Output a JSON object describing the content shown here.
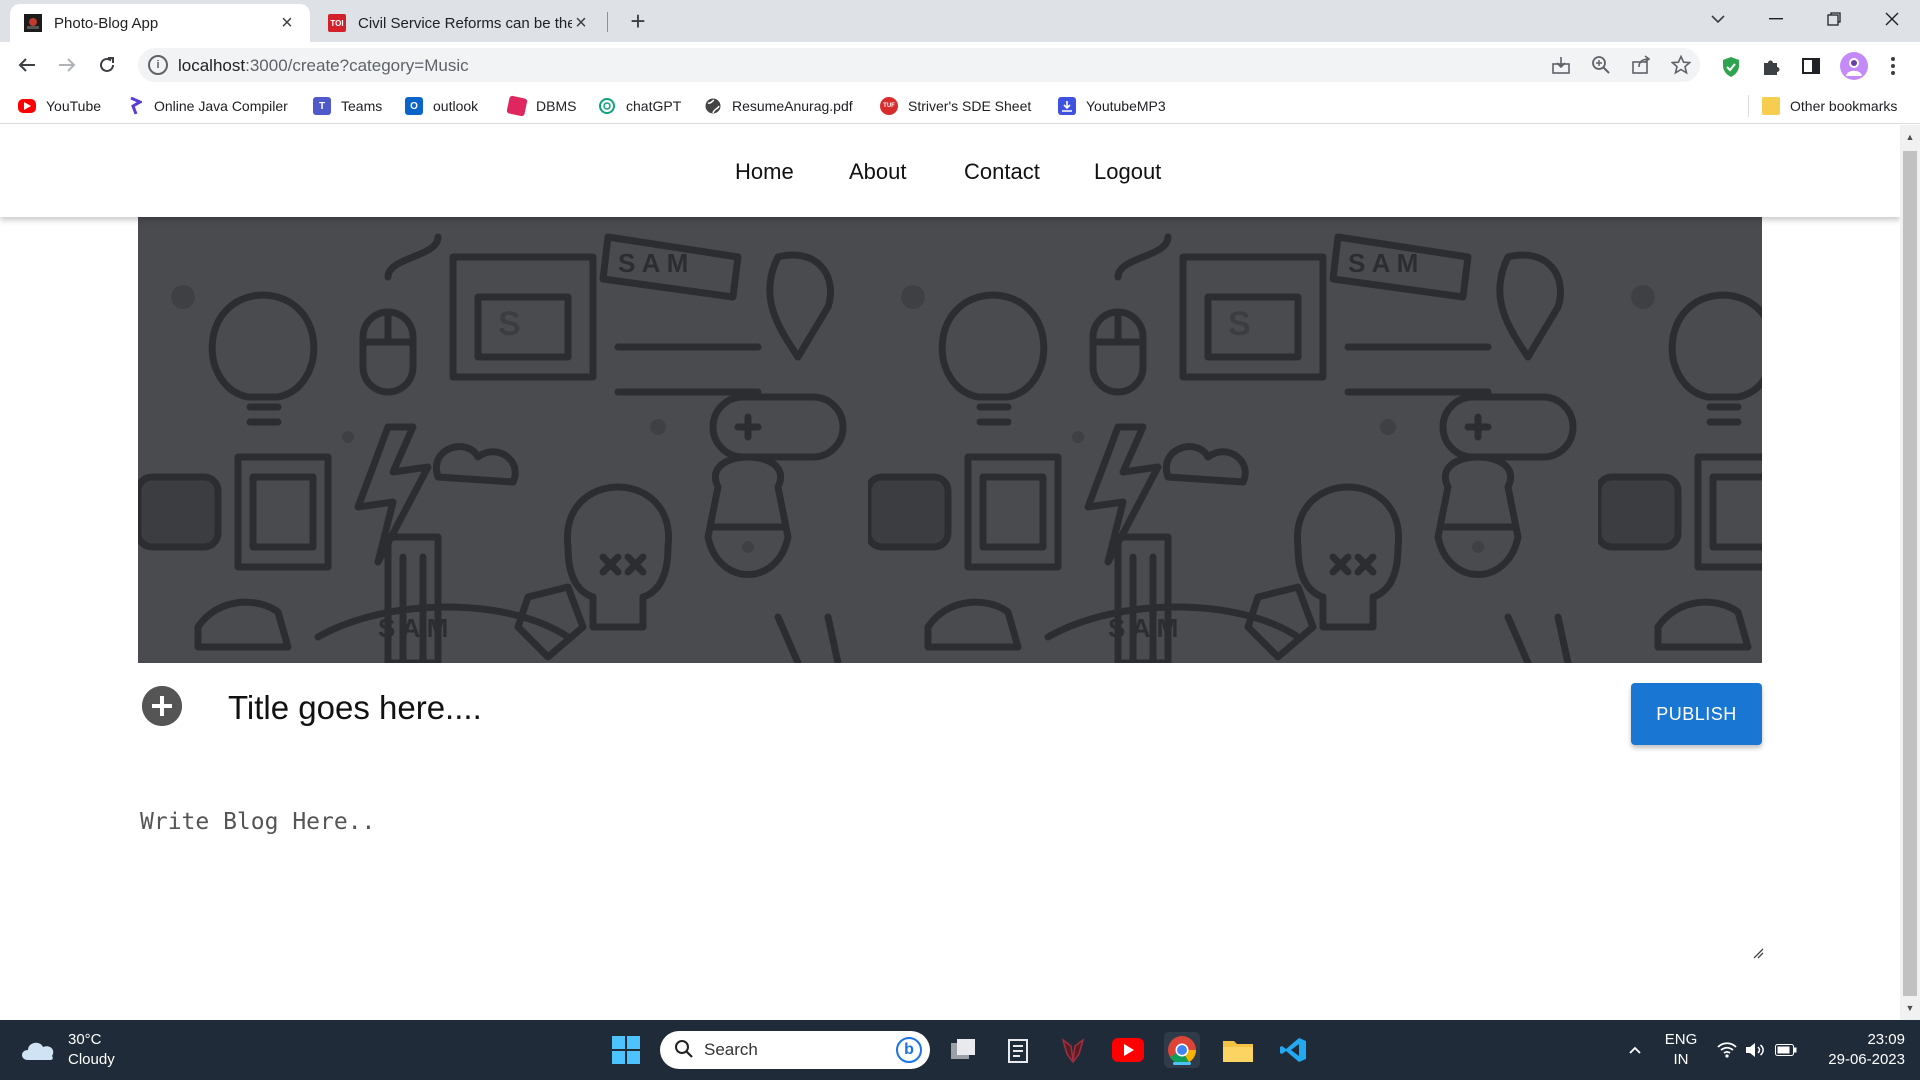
{
  "browser": {
    "tabs": [
      {
        "title": "Photo-Blog App",
        "active": true
      },
      {
        "title": "Civil Service Reforms can be the I",
        "active": false,
        "favicon_text": "TOI"
      }
    ],
    "url": {
      "host": "localhost",
      "rest": ":3000/create?category=Music"
    },
    "bookmarks": [
      {
        "label": "YouTube",
        "icon": "youtube-icon",
        "color": "#ff0000"
      },
      {
        "label": "Online Java Compiler",
        "icon": "programiz-icon",
        "color": "#5b3ed6"
      },
      {
        "label": "Teams",
        "icon": "teams-icon",
        "color": "#5059c9"
      },
      {
        "label": "outlook",
        "icon": "outlook-icon",
        "color": "#0a64c9"
      },
      {
        "label": "DBMS",
        "icon": "dbms-icon",
        "color": "#e0265f"
      },
      {
        "label": "chatGPT",
        "icon": "chatgpt-icon",
        "color": "#10a37f"
      },
      {
        "label": "ResumeAnurag.pdf",
        "icon": "globe-icon",
        "color": "#444444"
      },
      {
        "label": "Striver's SDE Sheet",
        "icon": "tuf-icon",
        "color": "#d92c2c"
      },
      {
        "label": "YoutubeMP3",
        "icon": "download-icon",
        "color": "#3f51e0"
      }
    ],
    "other_bookmarks": "Other bookmarks"
  },
  "site": {
    "nav": [
      "Home",
      "About",
      "Contact",
      "Logout"
    ],
    "title_placeholder": "Title goes here....",
    "publish_label": "PUBLISH",
    "blog_placeholder": "Write Blog Here..",
    "accent_color": "#1976d2"
  },
  "taskbar": {
    "temperature": "30°C",
    "condition": "Cloudy",
    "search_label": "Search",
    "lang_top": "ENG",
    "lang_bottom": "IN",
    "time": "23:09",
    "date": "29-06-2023"
  }
}
